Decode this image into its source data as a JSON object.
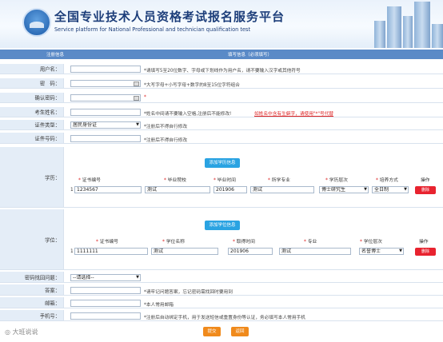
{
  "header": {
    "title": "全国专业技术人员资格考试报名服务平台",
    "subtitle": "Service platform for National Professional and technician qualification test"
  },
  "tabs": {
    "left": "注册信息",
    "right": "填写信息（必须填写）"
  },
  "form": {
    "username": {
      "label": "用户名：",
      "hint": "*请填写5至20位数字、字母或下划线作为用户名，请不要输入汉字或其他符号"
    },
    "password": {
      "label": "密　码：",
      "hint": "*大写字母+小写字母+数字的8至15位字符组合"
    },
    "confirm": {
      "label": "确认密码：",
      "hint": "*"
    },
    "name": {
      "label": "考生姓名：",
      "hint": "*姓名中间请不要输入空格,注册后不能修改!",
      "hint_red": "如姓名中含有生僻字，请使用\"*\"号代替"
    },
    "idtype": {
      "label": "证件类型：",
      "value": "居民身份证",
      "hint": "*注册后不得自行修改"
    },
    "idnum": {
      "label": "证件号码：",
      "hint": "*注册后不得自行修改"
    },
    "education": {
      "label": "学历：",
      "add_button": "添加学历信息",
      "headers": [
        "证书编号",
        "毕业院校",
        "毕业时间",
        "所学专业",
        "学历层次",
        "培养方式",
        "操作"
      ],
      "row": {
        "index": "1",
        "cert": "1234567",
        "school": "测试",
        "time": "201906",
        "major": "测试",
        "level": "博士研究生",
        "mode": "全日制",
        "delete": "删除"
      }
    },
    "degree": {
      "label": "学位：",
      "add_button": "添加学位信息",
      "headers": [
        "证书编号",
        "学位名称",
        "取得时间",
        "专业",
        "学位层次",
        "操作"
      ],
      "row": {
        "index": "1",
        "cert": "1111111",
        "name": "测试",
        "time": "201906",
        "major": "测试",
        "level": "名誉博士",
        "delete": "删除"
      }
    },
    "question": {
      "label": "密码找回问题：",
      "value": "--请选择--"
    },
    "answer": {
      "label": "答案：",
      "hint": "*请牢记问题答案，忘记密码需找回时要用到"
    },
    "email": {
      "label": "邮箱：",
      "hint": "*本人常用邮箱"
    },
    "phone": {
      "label": "手机号：",
      "hint": "*注册后自动绑定手机，用于发送短信或重置身份等认证，务必填写本人常用手机"
    }
  },
  "buttons": {
    "submit": "提交",
    "back": "返回"
  },
  "watermark": "大班说说"
}
